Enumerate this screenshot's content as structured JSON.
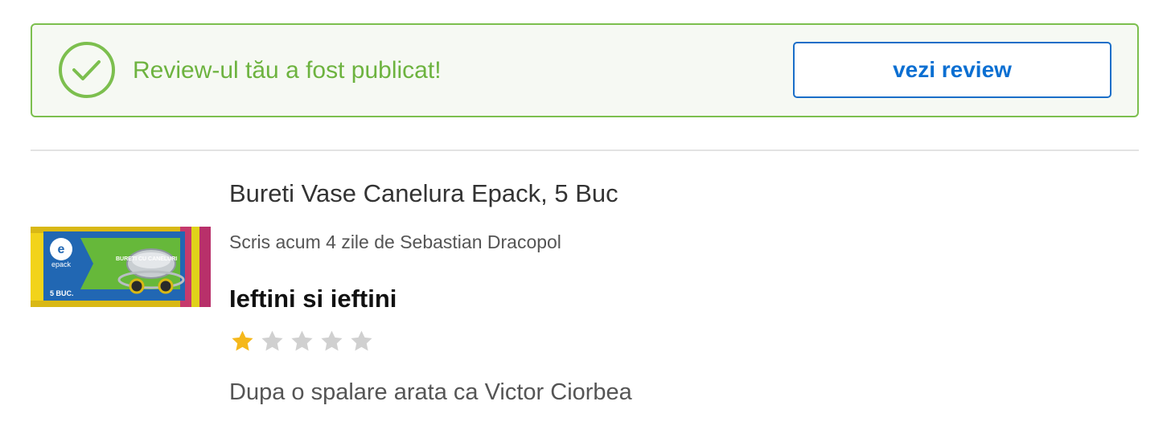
{
  "banner": {
    "message": "Review-ul tău a fost publicat!",
    "button_label": "vezi review",
    "icon": "check-circle-icon",
    "colors": {
      "success": "#6db33f",
      "accent": "#0b6fd2"
    }
  },
  "review": {
    "product_title": "Bureti Vase Canelura Epack, 5 Buc",
    "meta": "Scris acum 4 zile de Sebastian Dracopol",
    "title": "Ieftini si ieftini",
    "rating": 1,
    "rating_max": 5,
    "body": "Dupa o spalare arata ca Victor Ciorbea",
    "colors": {
      "star_filled": "#f5b81c",
      "star_empty": "#d0d0d0"
    }
  },
  "product_image": {
    "brand": "epack",
    "label": "BURETI CU CANELURI",
    "count": "5 BUC."
  }
}
